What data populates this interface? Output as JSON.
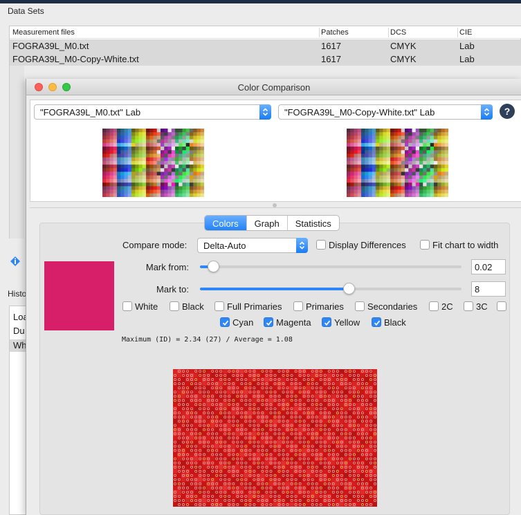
{
  "data_sets": {
    "title": "Data Sets",
    "columns": [
      "Measurement files",
      "Patches",
      "DCS",
      "CIE"
    ],
    "rows": [
      [
        "FOGRA39L_M0.txt",
        "1617",
        "CMYK",
        "Lab"
      ],
      [
        "FOGRA39L_M0-Copy-White.txt",
        "1617",
        "CMYK",
        "Lab"
      ]
    ]
  },
  "history": {
    "title": "Histo",
    "items": [
      "Loa",
      "Du",
      "Wh"
    ]
  },
  "window": {
    "title": "Color Comparison",
    "left_select": "\"FOGRA39L_M0.txt\" Lab",
    "right_select": "\"FOGRA39L_M0-Copy-White.txt\" Lab",
    "help_label": "?"
  },
  "tabs": [
    "Colors",
    "Graph",
    "Statistics"
  ],
  "active_tab": "Colors",
  "controls": {
    "compare_mode_label": "Compare mode:",
    "compare_mode_value": "Delta-Auto",
    "display_differences_label": "Display Differences",
    "display_differences_checked": false,
    "fit_chart_label": "Fit chart to width",
    "fit_chart_checked": false,
    "mark_from_label": "Mark from:",
    "mark_from_value": "0.02",
    "mark_from_fraction": 0.05,
    "mark_to_label": "Mark to:",
    "mark_to_value": "8",
    "mark_to_fraction": 0.57
  },
  "filters_row1": [
    {
      "label": "White",
      "checked": false
    },
    {
      "label": "Black",
      "checked": false
    },
    {
      "label": "Full Primaries",
      "checked": false
    },
    {
      "label": "Primaries",
      "checked": false
    },
    {
      "label": "Secondaries",
      "checked": false
    },
    {
      "label": "2C",
      "checked": false
    },
    {
      "label": "3C",
      "checked": false
    }
  ],
  "filters_row2": [
    {
      "label": "Cyan",
      "checked": true
    },
    {
      "label": "Magenta",
      "checked": true
    },
    {
      "label": "Yellow",
      "checked": true
    },
    {
      "label": "Black",
      "checked": true
    }
  ],
  "stats_text": "Maximum (ID) = 2.34 (27) / Average = 1.08",
  "colors": {
    "swatch": "#d61e69",
    "accent": "#2f86f6",
    "diff_base": "#e0161c"
  }
}
